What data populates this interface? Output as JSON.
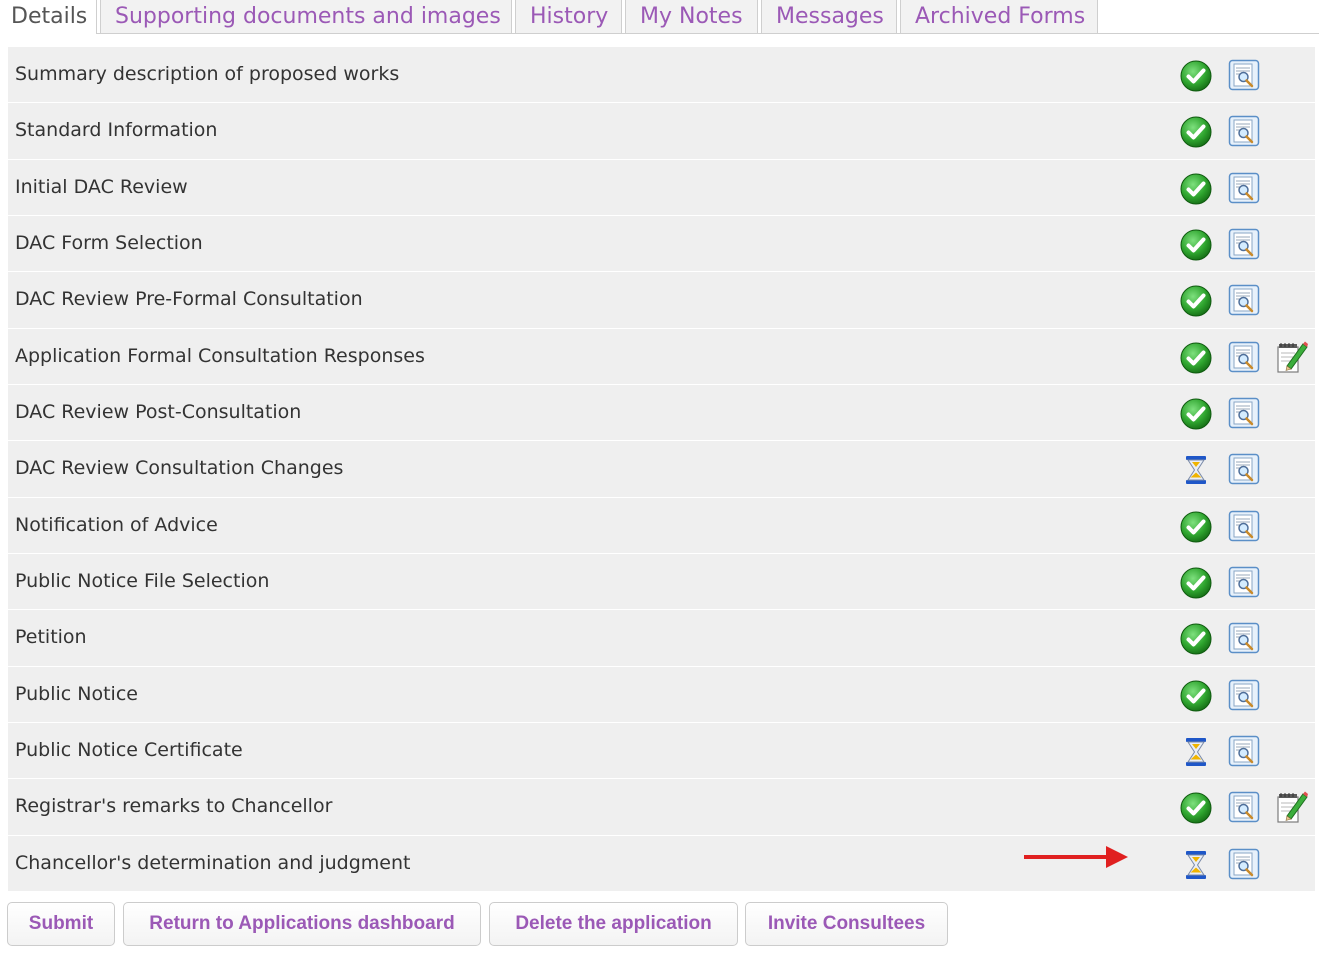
{
  "tabs": [
    {
      "label": "Details",
      "active": true
    },
    {
      "label": "Supporting documents and images"
    },
    {
      "label": "History"
    },
    {
      "label": "My Notes"
    },
    {
      "label": "Messages"
    },
    {
      "label": "Archived Forms"
    }
  ],
  "rows": [
    {
      "label": "Summary description of proposed works",
      "status": "check-icon",
      "editable": false
    },
    {
      "label": "Standard Information",
      "status": "check-icon",
      "editable": false
    },
    {
      "label": "Initial DAC Review",
      "status": "check-icon",
      "editable": false
    },
    {
      "label": "DAC Form Selection",
      "status": "check-icon",
      "editable": false
    },
    {
      "label": "DAC Review Pre-Formal Consultation",
      "status": "check-icon",
      "editable": false
    },
    {
      "label": "Application Formal Consultation Responses",
      "status": "check-icon",
      "editable": true
    },
    {
      "label": "DAC Review Post-Consultation",
      "status": "check-icon",
      "editable": false
    },
    {
      "label": "DAC Review Consultation Changes",
      "status": "hourglass-icon",
      "editable": false
    },
    {
      "label": "Notification of Advice",
      "status": "check-icon",
      "editable": false
    },
    {
      "label": "Public Notice File Selection",
      "status": "check-icon",
      "editable": false
    },
    {
      "label": "Petition",
      "status": "check-icon",
      "editable": false
    },
    {
      "label": "Public Notice",
      "status": "check-icon",
      "editable": false
    },
    {
      "label": "Public Notice Certificate",
      "status": "hourglass-icon",
      "editable": false
    },
    {
      "label": "Registrar's remarks to Chancellor",
      "status": "check-icon",
      "editable": true
    },
    {
      "label": "Chancellor's determination and judgment",
      "status": "hourglass-icon",
      "editable": false
    }
  ],
  "buttons": {
    "submit": "Submit",
    "return": "Return to Applications dashboard",
    "delete": "Delete the application",
    "invite": "Invite Consultees"
  },
  "colors": {
    "accent": "#9b59b6",
    "row_bg": "#efefef",
    "check_green": "#2fa52f",
    "arrow_red": "#e02020"
  }
}
